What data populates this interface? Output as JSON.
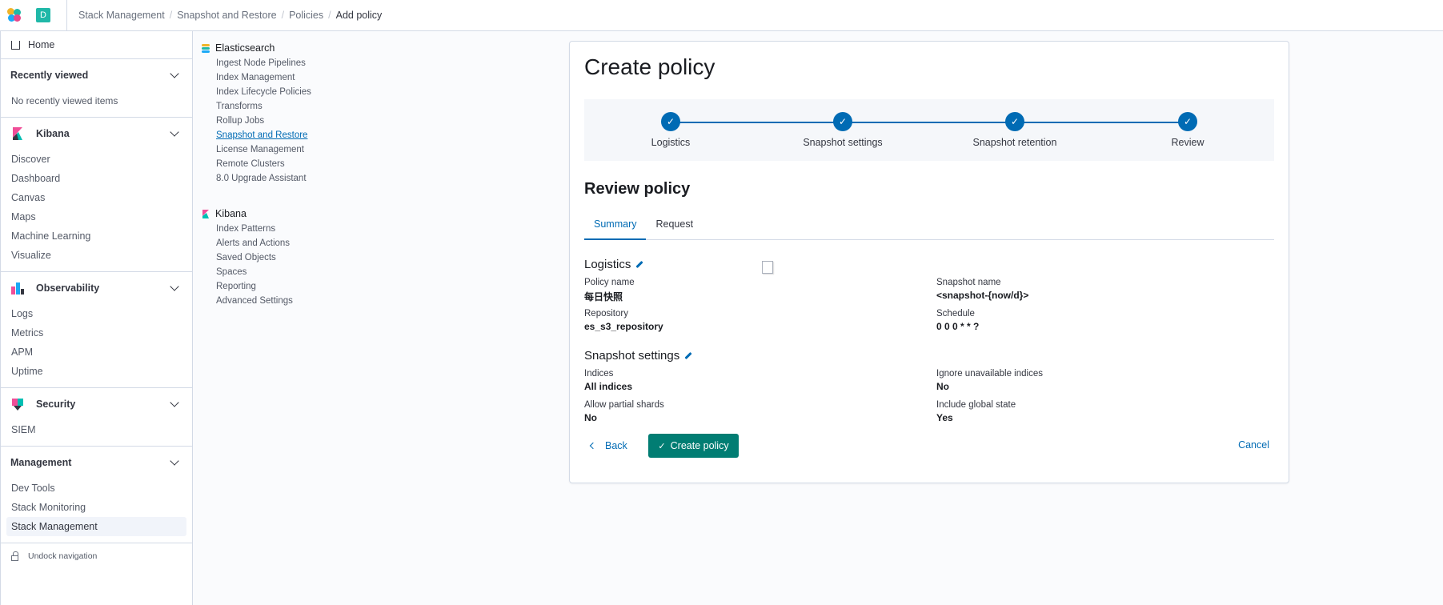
{
  "header": {
    "avatar": "D",
    "breadcrumbs": [
      "Stack Management",
      "Snapshot and Restore",
      "Policies",
      "Add policy"
    ]
  },
  "nav": {
    "home": "Home",
    "recent": {
      "title": "Recently viewed",
      "empty": "No recently viewed items"
    },
    "kibana": {
      "title": "Kibana",
      "items": [
        "Discover",
        "Dashboard",
        "Canvas",
        "Maps",
        "Machine Learning",
        "Visualize"
      ]
    },
    "observability": {
      "title": "Observability",
      "items": [
        "Logs",
        "Metrics",
        "APM",
        "Uptime"
      ]
    },
    "security": {
      "title": "Security",
      "items": [
        "SIEM"
      ]
    },
    "management": {
      "title": "Management",
      "items": [
        "Dev Tools",
        "Stack Monitoring",
        "Stack Management"
      ]
    },
    "undock": "Undock navigation"
  },
  "mgmt": {
    "elasticsearch": {
      "title": "Elasticsearch",
      "items": [
        "Ingest Node Pipelines",
        "Index Management",
        "Index Lifecycle Policies",
        "Transforms",
        "Rollup Jobs",
        "Snapshot and Restore",
        "License Management",
        "Remote Clusters",
        "8.0 Upgrade Assistant"
      ]
    },
    "kibana": {
      "title": "Kibana",
      "items": [
        "Index Patterns",
        "Alerts and Actions",
        "Saved Objects",
        "Spaces",
        "Reporting",
        "Advanced Settings"
      ]
    }
  },
  "page": {
    "title": "Create policy",
    "steps": [
      "Logistics",
      "Snapshot settings",
      "Snapshot retention",
      "Review"
    ],
    "review_title": "Review policy",
    "tabs": [
      "Summary",
      "Request"
    ],
    "logistics": {
      "title": "Logistics",
      "policy_name_label": "Policy name",
      "policy_name": "每日快照",
      "repository_label": "Repository",
      "repository": "es_s3_repository",
      "snapshot_name_label": "Snapshot name",
      "snapshot_name": "<snapshot-{now/d}>",
      "schedule_label": "Schedule",
      "schedule": "0 0 0 * * ?"
    },
    "settings": {
      "title": "Snapshot settings",
      "indices_label": "Indices",
      "indices": "All indices",
      "partial_label": "Allow partial shards",
      "partial": "No",
      "ignore_label": "Ignore unavailable indices",
      "ignore": "No",
      "global_label": "Include global state",
      "global": "Yes"
    },
    "buttons": {
      "back": "Back",
      "create": "Create policy",
      "cancel": "Cancel"
    }
  },
  "colors": {
    "primary": "#006bb4",
    "success": "#017d73"
  }
}
